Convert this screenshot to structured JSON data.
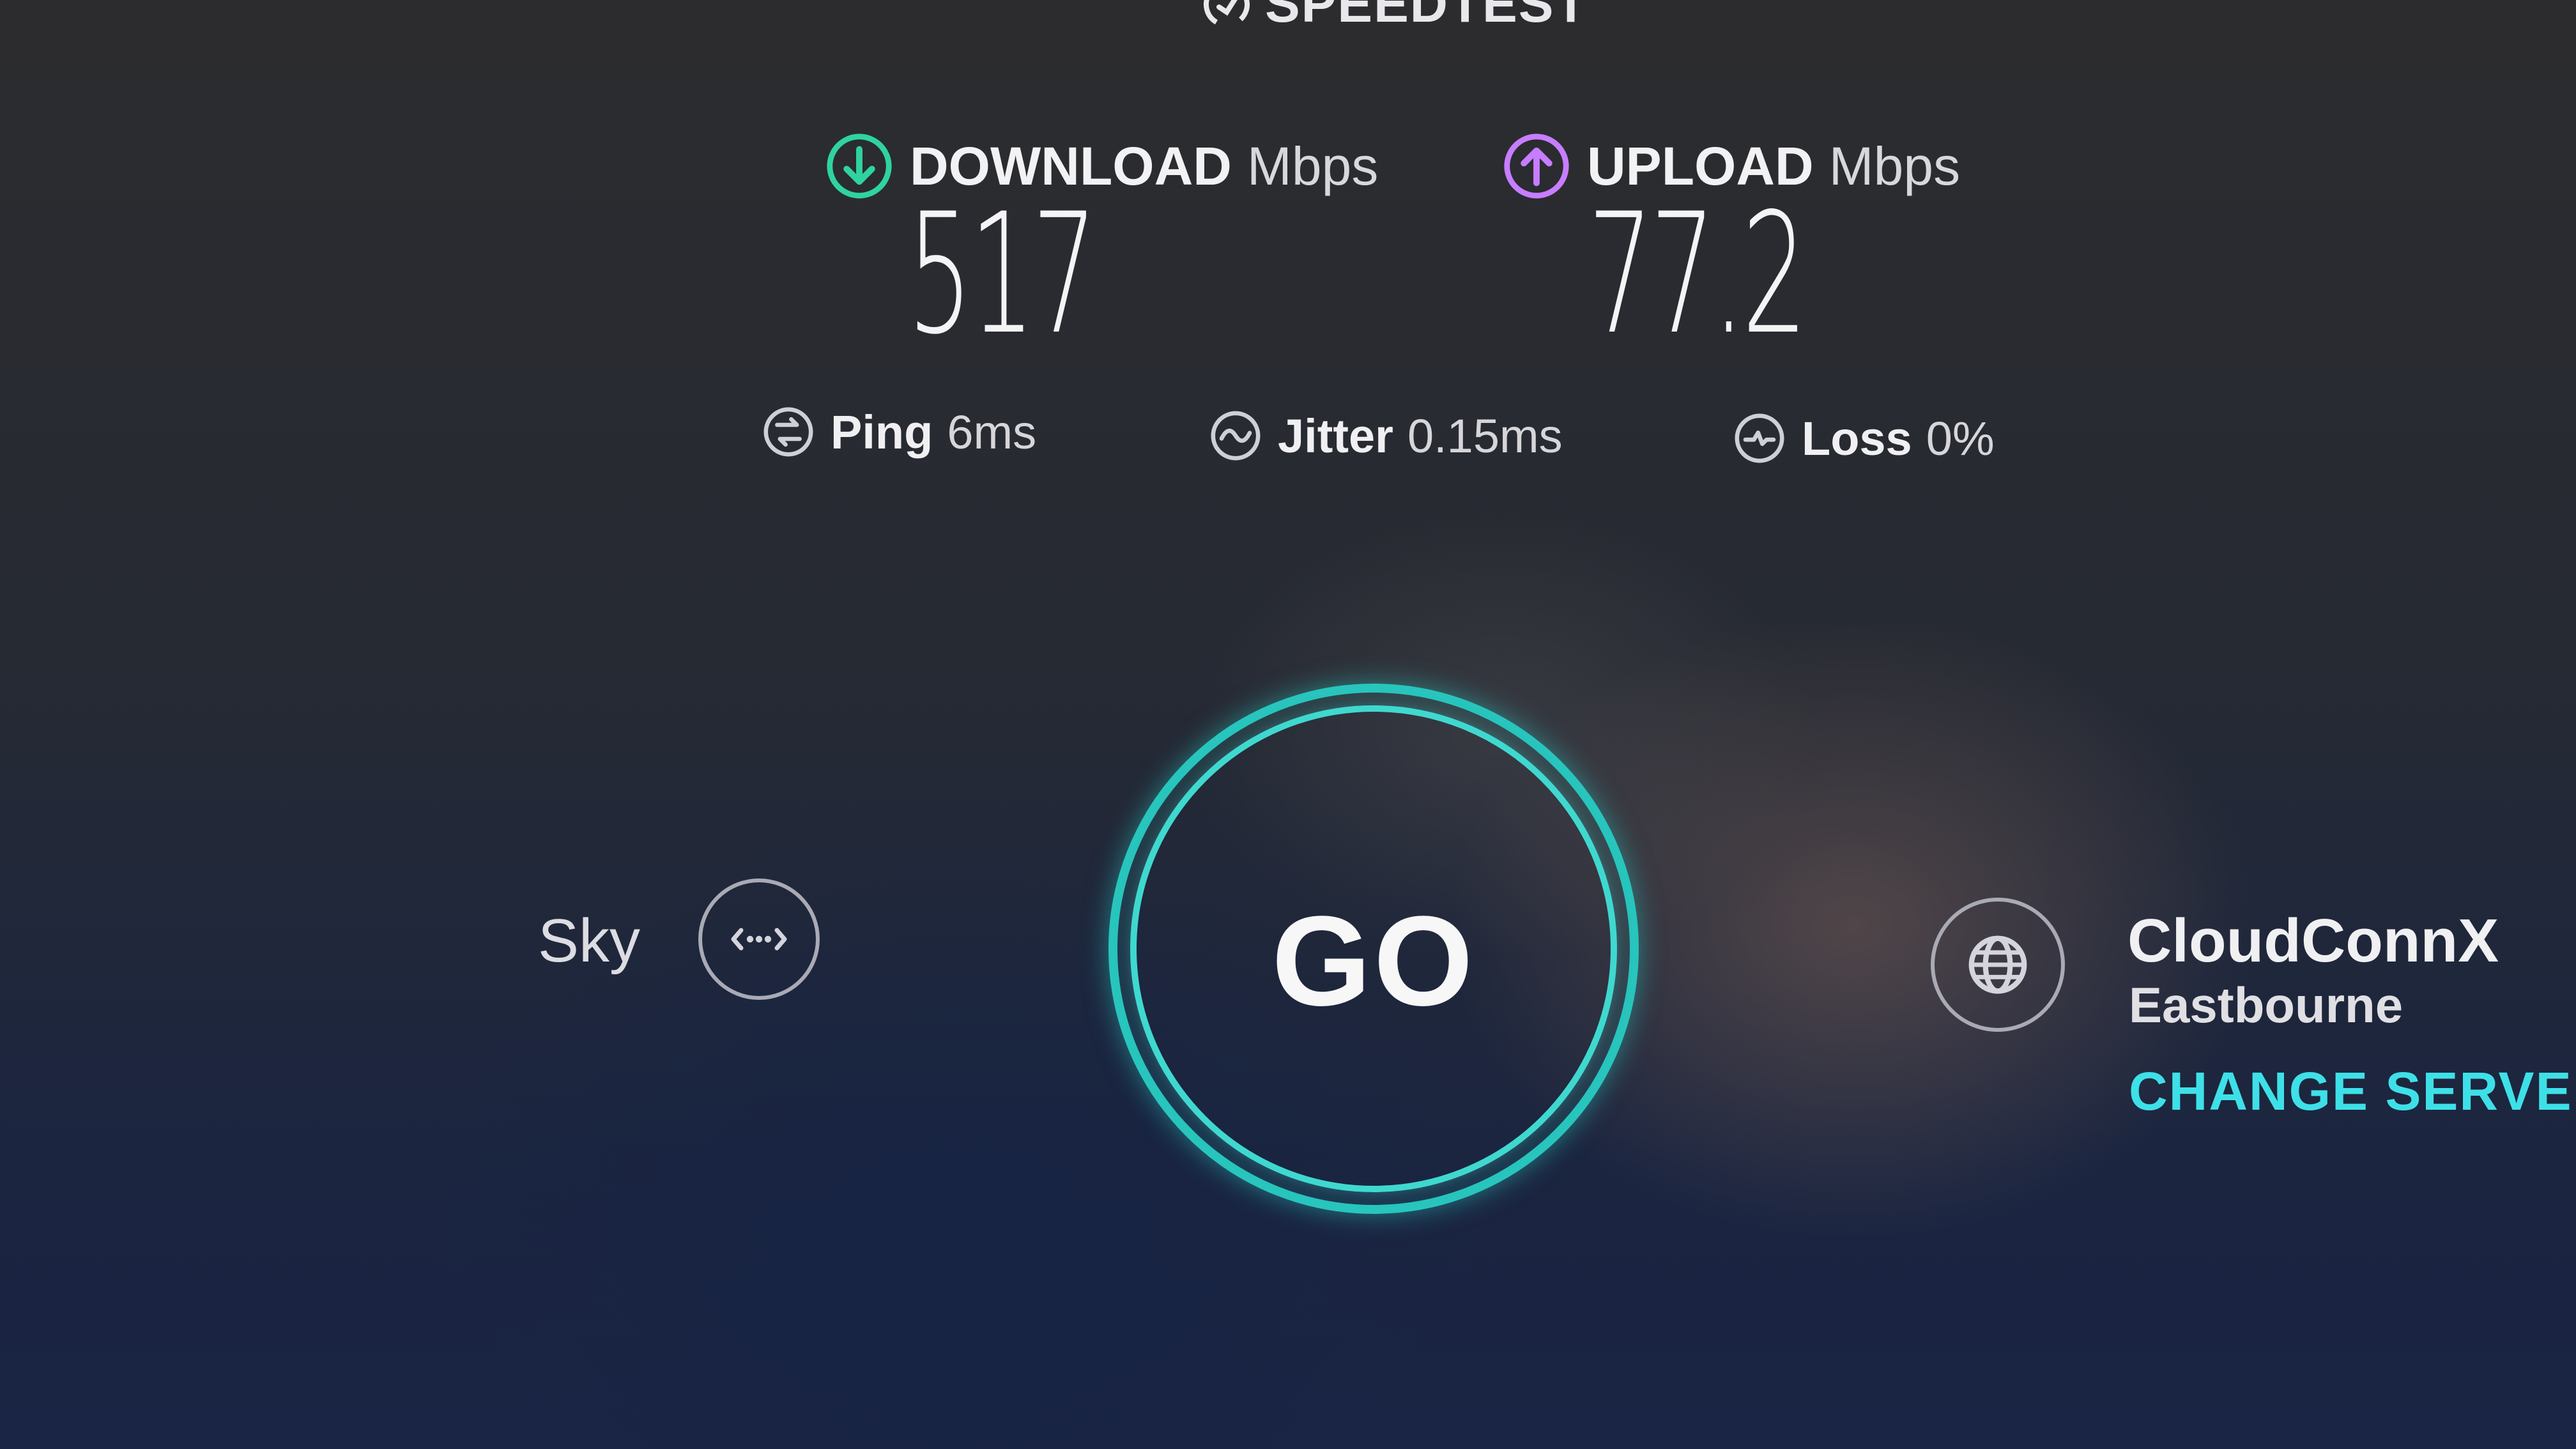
{
  "app": {
    "logo_text": "SPEEDTEST",
    "logo_icon": "speedometer-icon"
  },
  "download": {
    "title": "DOWNLOAD",
    "unit": "Mbps",
    "value": "517",
    "icon": "download-arrow-icon",
    "color": "#2fd3a0"
  },
  "upload": {
    "title": "UPLOAD",
    "unit": "Mbps",
    "value": "77.2",
    "icon": "upload-arrow-icon",
    "color": "#c77dff"
  },
  "stats": {
    "ping": {
      "label": "Ping",
      "value": "6ms",
      "icon": "ping-icon"
    },
    "jitter": {
      "label": "Jitter",
      "value": "0.15ms",
      "icon": "jitter-icon"
    },
    "loss": {
      "label": "Loss",
      "value": "0%",
      "icon": "loss-icon"
    }
  },
  "go_button": {
    "label": "GO",
    "ring_color": "#28c5bd"
  },
  "isp": {
    "name": "Sky",
    "icon": "connection-dots-icon"
  },
  "server": {
    "name": "CloudConnX",
    "location": "Eastbourne",
    "change_label": "CHANGE SERVE",
    "icon": "globe-icon",
    "accent": "#3ee0e8"
  }
}
